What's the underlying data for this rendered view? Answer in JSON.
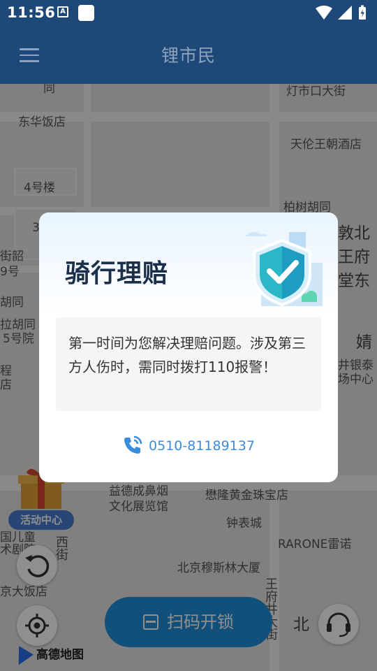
{
  "status_bar": {
    "time": "11:56",
    "notif_letter": "A"
  },
  "app_bar": {
    "title": "锂市民"
  },
  "map": {
    "labels": [
      "同",
      "灯市口大街",
      "东华饭店",
      "天伦王朝酒店",
      "4号楼",
      "柏树胡同",
      "3",
      "街韶",
      "9号",
      "胡同",
      "拉胡同",
      "5号院",
      "程",
      "店",
      "国儿童",
      "术剧院",
      "京大饭店",
      "益德成鼻烟",
      "文化展览馆",
      "懋隆黄金珠宝店",
      "钟表城",
      "RARONE雷诺",
      "北京穆斯林大厦",
      "王府井大街",
      "北",
      "敦北",
      "王府",
      "堂东",
      "婧",
      "井银泰",
      "场中心",
      "西街"
    ],
    "brand": "高德地图"
  },
  "activity": {
    "label": "活动中心"
  },
  "scan_button": {
    "label": "扫码开锁"
  },
  "dialog": {
    "title": "骑行理赔",
    "body": "第一时间为您解决理赔问题。涉及第三方人伤时，需同时拨打110报警！",
    "phone": "0510-81189137"
  },
  "colors": {
    "primary": "#1d4877",
    "accent": "#3a8ddc",
    "scan": "#1f8fd9"
  }
}
